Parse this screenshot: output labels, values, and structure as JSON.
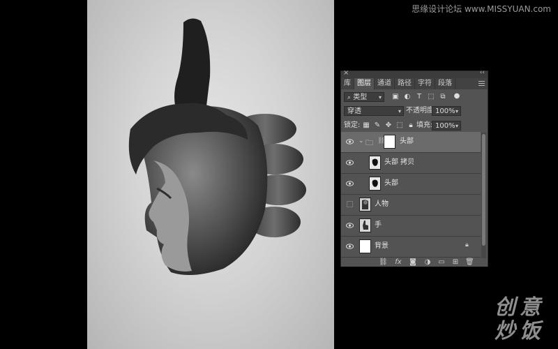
{
  "watermark": {
    "site": "思缘设计论坛 www.MISSYUAN.com",
    "logo": [
      "创",
      "意",
      "炒",
      "饭"
    ]
  },
  "panel": {
    "tabs": [
      {
        "label": "库",
        "active": false
      },
      {
        "label": "图层",
        "active": true
      },
      {
        "label": "通道",
        "active": false
      },
      {
        "label": "路径",
        "active": false
      },
      {
        "label": "字符",
        "active": false
      },
      {
        "label": "段落",
        "active": false
      }
    ],
    "filter": {
      "kind": "类型"
    },
    "blend_mode": "穿透",
    "opacity_label": "不透明度:",
    "opacity_value": "100%",
    "lock_label": "锁定:",
    "fill_label": "填充:",
    "fill_value": "100%",
    "layers": [
      {
        "name": "头部",
        "type": "group",
        "visible": true,
        "selected": true
      },
      {
        "name": "头部 拷贝",
        "type": "layer",
        "visible": true,
        "selected": false
      },
      {
        "name": "头部",
        "type": "layer",
        "visible": true,
        "selected": false
      },
      {
        "name": "人物",
        "type": "layer",
        "visible": false,
        "selected": false
      },
      {
        "name": "手",
        "type": "layer",
        "visible": true,
        "selected": false
      },
      {
        "name": "背景",
        "type": "background",
        "visible": true,
        "selected": false,
        "locked": true
      }
    ],
    "bottom_icons": [
      "link-icon",
      "fx-icon",
      "mask-icon",
      "adjustment-icon",
      "folder-icon",
      "new-layer-icon",
      "trash-icon"
    ],
    "fx_label": "fx"
  },
  "colors": {
    "panel_bg": "#535353",
    "selected_row": "#6b6b6b",
    "canvas_bg": "#d9d9d9"
  }
}
